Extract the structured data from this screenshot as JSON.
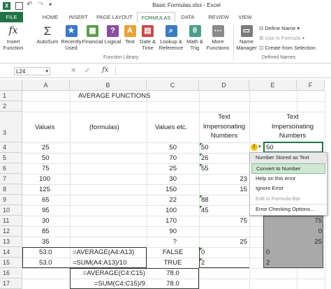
{
  "window": {
    "title": "Basic Formulas.xlsx - Excel"
  },
  "tabs": [
    "FILE",
    "HOME",
    "INSERT",
    "PAGE LAYOUT",
    "FORMULAS",
    "DATA",
    "REVIEW",
    "VIEW"
  ],
  "ribbon": {
    "insert_function": [
      "Insert",
      "Function"
    ],
    "autosum": "AutoSum",
    "recently_used": [
      "Recently",
      "Used"
    ],
    "financial": "Financial",
    "logical": "Logical",
    "text": "Text",
    "date_time": [
      "Date &",
      "Time"
    ],
    "lookup": [
      "Lookup &",
      "Reference"
    ],
    "math": [
      "Math &",
      "Trig"
    ],
    "more": [
      "More",
      "Functions"
    ],
    "function_library": "Function Library",
    "name_manager": [
      "Name",
      "Manager"
    ],
    "define_name": "Define Name",
    "use_in_formula": "Use in Formula",
    "create_from_selection": "Create from Selection",
    "defined_names": "Defined Names"
  },
  "formula_bar": {
    "name_box": "L24",
    "fx": "fx",
    "content": ""
  },
  "columns": [
    "A",
    "B",
    "C",
    "D",
    "E",
    "F"
  ],
  "rows": [
    "1",
    "2",
    "3",
    "4",
    "5",
    "6",
    "7",
    "8",
    "9",
    "10",
    "11",
    "12",
    "13",
    "14",
    "15",
    "16",
    "17"
  ],
  "cells": {
    "B1": "AVERAGE FUNCTIONS",
    "A3": "Values",
    "B3": "(formulas)",
    "C3": "Values etc.",
    "D3": [
      "Text",
      "Impersonating",
      "Numbers"
    ],
    "E3": [
      "Text",
      "Impersonating",
      "Numbers"
    ],
    "A": [
      "25",
      "50",
      "75",
      "100",
      "125",
      "65",
      "95",
      "30",
      "85",
      "35"
    ],
    "C": [
      "50",
      "70",
      "25",
      "30",
      "150",
      "22",
      "100",
      "170",
      "90",
      "?"
    ],
    "D_left": {
      "4": "50",
      "5": "26",
      "6": "55",
      "9": "88",
      "10": "45"
    },
    "D_right": {
      "7": "23",
      "8": "15",
      "11": "75",
      "13": "25"
    },
    "E4": "50",
    "F": {
      "11": "75",
      "12": "0",
      "13": "25"
    },
    "A14": "53.0",
    "B14": "=AVERAGE(A4:A13)",
    "C14": "FALSE",
    "D14": "0",
    "E14": "0",
    "A15": "53.0",
    "B15": "=SUM(A4:A13)/10",
    "C15": "TRUE",
    "D15": "2",
    "E15": "2",
    "B16": "=AVERAGE(C4:C15)",
    "C16": "78.0",
    "B17": "=SUM(C4:C15)/9",
    "C17": "78.0"
  },
  "error_menu": [
    "Number Stored as Text",
    "Convert to Number",
    "Help on this error",
    "Ignore Error",
    "Edit in Formula Bar",
    "Error Checking Options..."
  ],
  "colors": {
    "excel_green": "#217346",
    "selection_gray": "#a9a9a9",
    "menu_highlight": "#cfe8d3"
  }
}
